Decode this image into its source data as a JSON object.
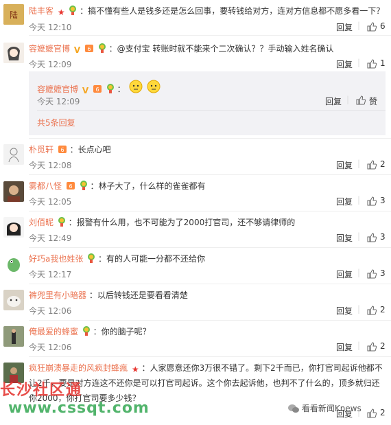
{
  "comments": [
    {
      "name": "陆丰客",
      "text": "：搞不懂有些人是钱多还是怎么回事，要转钱给对方，连对方信息都不愿多看一下？",
      "time": "今天 12:10",
      "reply": "回复",
      "likes": "6"
    },
    {
      "name": "容嬷嬷官博",
      "text": "：@支付宝  转账时就不能来个二次确认？？手动输入姓名确认",
      "time": "今天 12:09",
      "reply": "回复",
      "likes": "1"
    },
    {
      "name": "朴觅轩",
      "text": "：长点心吧",
      "time": "今天 12:08",
      "reply": "回复",
      "likes": "2"
    },
    {
      "name": "雾都八怪",
      "text": "：林子大了，什么样的雀雀都有",
      "time": "今天 12:05",
      "reply": "回复",
      "likes": "3"
    },
    {
      "name": "刘佰昵",
      "text": "：报警有什么用，也不可能为了2000打官司，还不够请律师的",
      "time": "今天 12:49",
      "reply": "回复",
      "likes": "3"
    },
    {
      "name": "好巧a我也姓张",
      "text": "：有的人可能一分都不还给你",
      "time": "今天 12:17",
      "reply": "回复",
      "likes": "3"
    },
    {
      "name": "裤兜里有小暗器",
      "text": "：以后转钱还是要看看清楚",
      "time": "今天 12:06",
      "reply": "回复",
      "likes": "2"
    },
    {
      "name": "俺最爱的蜂蜜",
      "text": "：你的脑子呢？",
      "time": "今天 12:06",
      "reply": "回复",
      "likes": "2"
    },
    {
      "name": "疯狂崩溃暴走的风疯封蜂瘋",
      "text": "：人家愿意还你3万很不错了。剩下2千而已，你打官司起诉他都不",
      "text2": "让2千，要是对方连这不还你是可以打官司起诉。这个你去起诉他，也判不了什么的，顶多就归还",
      "text3": "你2000，你打官司要多少钱？",
      "reply": "回复",
      "likes": "2"
    }
  ],
  "nested_reply": {
    "name": "容嬷嬷官博",
    "text": "：",
    "time": "今天 12:09",
    "reply": "回复",
    "like_label": "赞"
  },
  "more_replies": "共5条回复",
  "watermarks": {
    "w1": "长沙社区通",
    "w2": "www.cssqt.com",
    "w3": "看看新闻Knews"
  },
  "colors": {
    "name": "#eb7350",
    "time": "#808080",
    "reply_bg": "#f2f2f5"
  }
}
